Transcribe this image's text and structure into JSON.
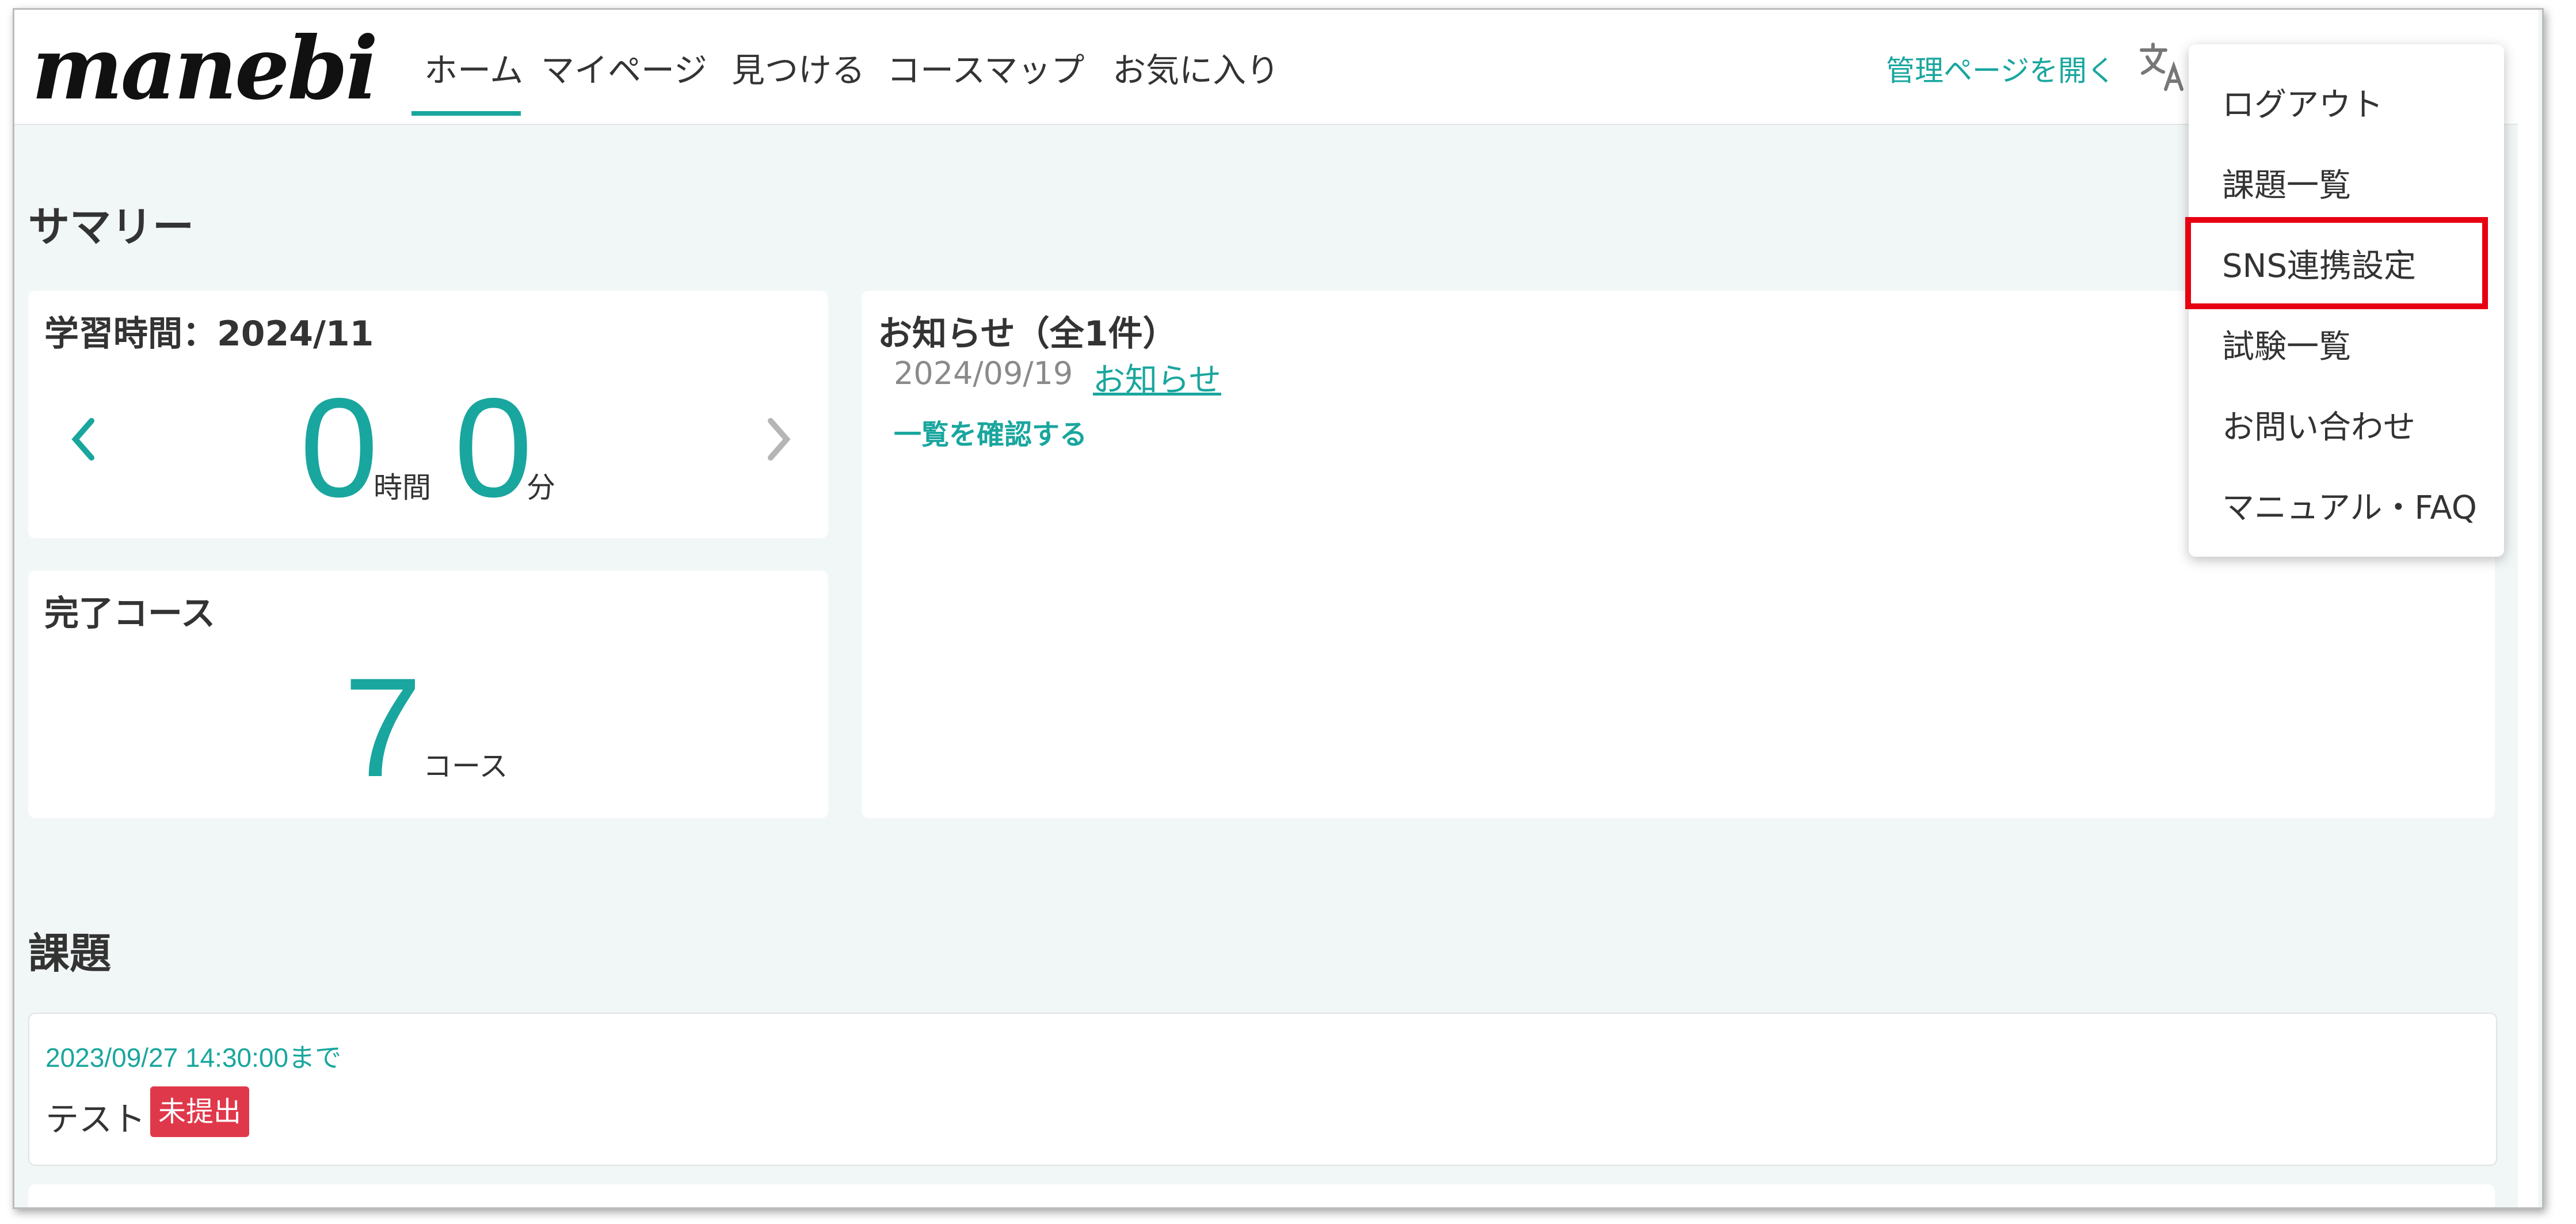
{
  "header": {
    "logo": "manebi",
    "nav": [
      {
        "label": "ホーム"
      },
      {
        "label": "マイページ"
      },
      {
        "label": "見つける"
      },
      {
        "label": "コースマップ"
      },
      {
        "label": "お気に入り"
      }
    ],
    "active_tab": "ホーム",
    "admin_link": "管理ページを開く",
    "translate_icon": "translate-icon"
  },
  "summary": {
    "title": "サマリー",
    "study_time": {
      "title": "学習時間：2024/11",
      "hours": "0",
      "hours_unit": "時間",
      "minutes": "0",
      "minutes_unit": "分"
    },
    "completed": {
      "title": "完了コース",
      "count": "7",
      "unit": "コース"
    },
    "notices": {
      "title": "お知らせ（全1件）",
      "items": [
        {
          "date": "2024/09/19",
          "label": "お知らせ"
        }
      ],
      "view_all": "一覧を確認する"
    }
  },
  "tasks": {
    "title": "課題",
    "items": [
      {
        "deadline": "2023/09/27 14:30:00まで",
        "name": "テスト",
        "status": "未提出"
      }
    ]
  },
  "dropdown": {
    "items": [
      {
        "label": "ログアウト"
      },
      {
        "label": "課題一覧"
      },
      {
        "label": "SNS連携設定"
      },
      {
        "label": "試験一覧"
      },
      {
        "label": "お問い合わせ"
      },
      {
        "label": "マニュアル・FAQ"
      }
    ],
    "highlighted": "SNS連携設定"
  },
  "colors": {
    "accent": "#19a69e",
    "badge": "#e0384b",
    "highlight_box": "#e60012",
    "background": "#f1f6f6"
  }
}
